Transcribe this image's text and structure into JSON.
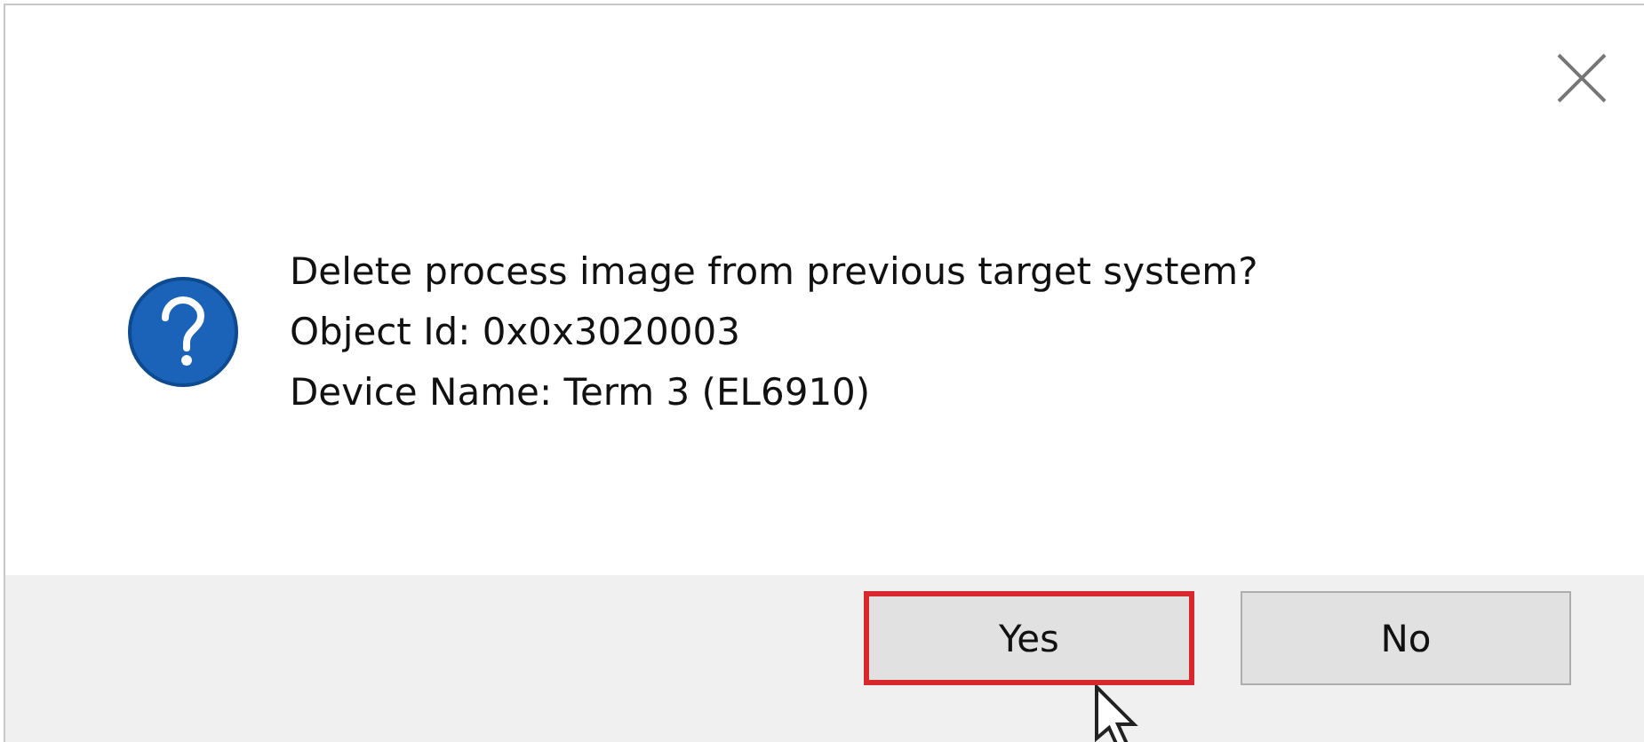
{
  "dialog": {
    "lines": [
      "Delete process image from previous target system?",
      "Object Id: 0x0x3020003",
      "Device Name: Term 3 (EL6910)"
    ],
    "buttons": [
      {
        "label": "Yes",
        "selected": true
      },
      {
        "label": "No",
        "selected": false
      }
    ]
  }
}
